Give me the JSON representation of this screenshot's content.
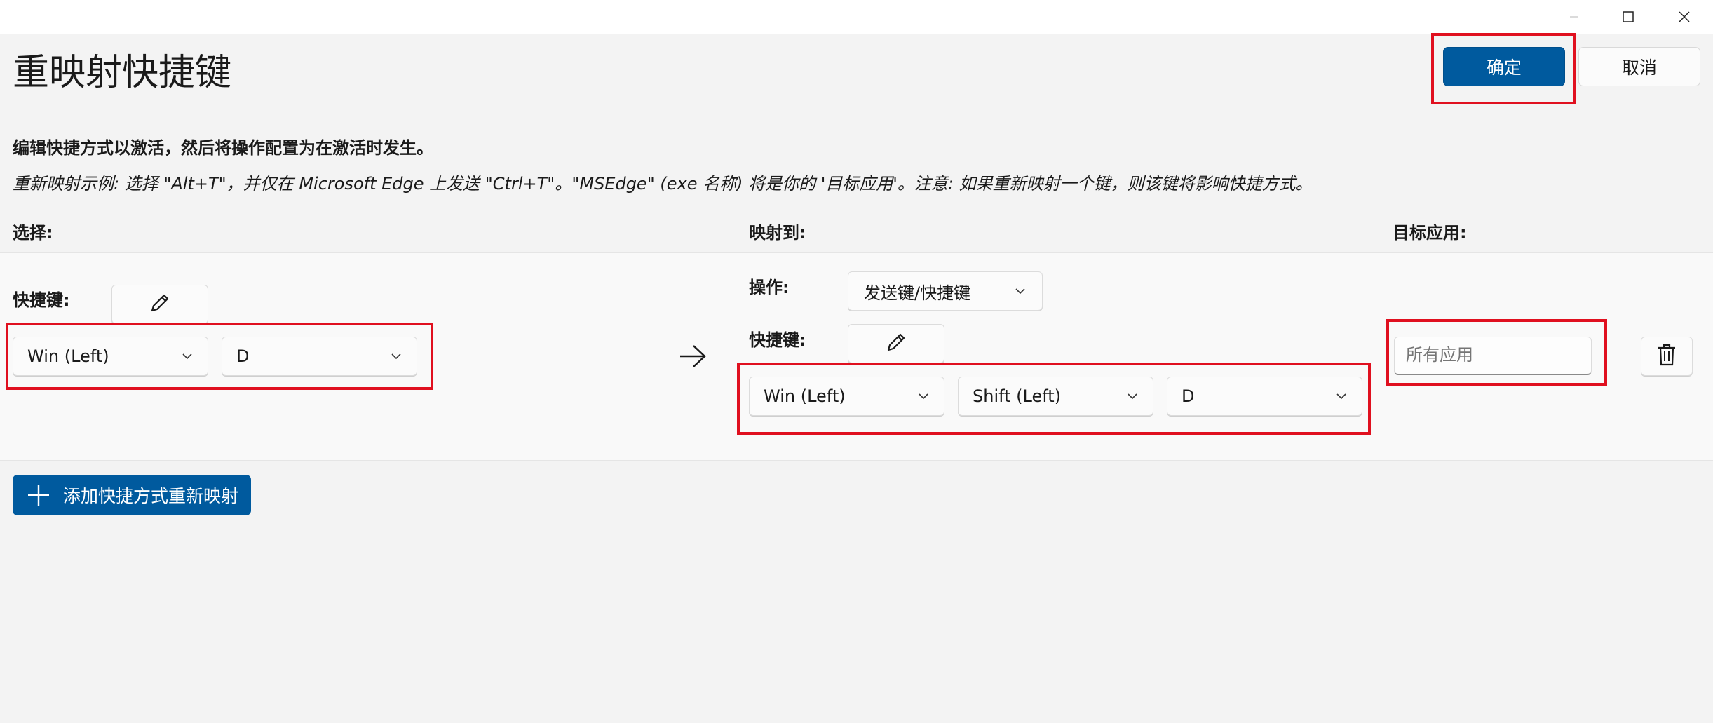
{
  "window": {
    "controls": [
      "minimize-icon",
      "maximize-icon",
      "close-icon"
    ]
  },
  "page": {
    "title": "重映射快捷键"
  },
  "header_buttons": {
    "ok_label": "确定",
    "cancel_label": "取消"
  },
  "instructions": {
    "bold": "编辑快捷方式以激活，然后将操作配置为在激活时发生。",
    "example": "重新映射示例: 选择 \"Alt+T\"，并仅在 Microsoft Edge 上发送 \"Ctrl+T\"。\"MSEdge\" (exe 名称) 将是你的 '目标应用'。注意: 如果重新映射一个键，则该键将影响快捷方式。"
  },
  "columns": {
    "select": "选择:",
    "map_to": "映射到:",
    "target_app": "目标应用:"
  },
  "row": {
    "source": {
      "shortcut_label": "快捷键:",
      "keys": [
        "Win (Left)",
        "D"
      ]
    },
    "arrow_icon": "arrow-right-icon",
    "mapping": {
      "action_label": "操作:",
      "action_value": "发送键/快捷键",
      "shortcut_label": "快捷键:",
      "keys": [
        "Win (Left)",
        "Shift (Left)",
        "D"
      ]
    },
    "target_app": {
      "placeholder": "所有应用"
    },
    "delete_icon": "trash-icon"
  },
  "add_button": {
    "label": "添加快捷方式重新映射"
  },
  "colors": {
    "accent": "#005a9e",
    "highlight": "#e0101f",
    "background": "#f3f3f3"
  }
}
